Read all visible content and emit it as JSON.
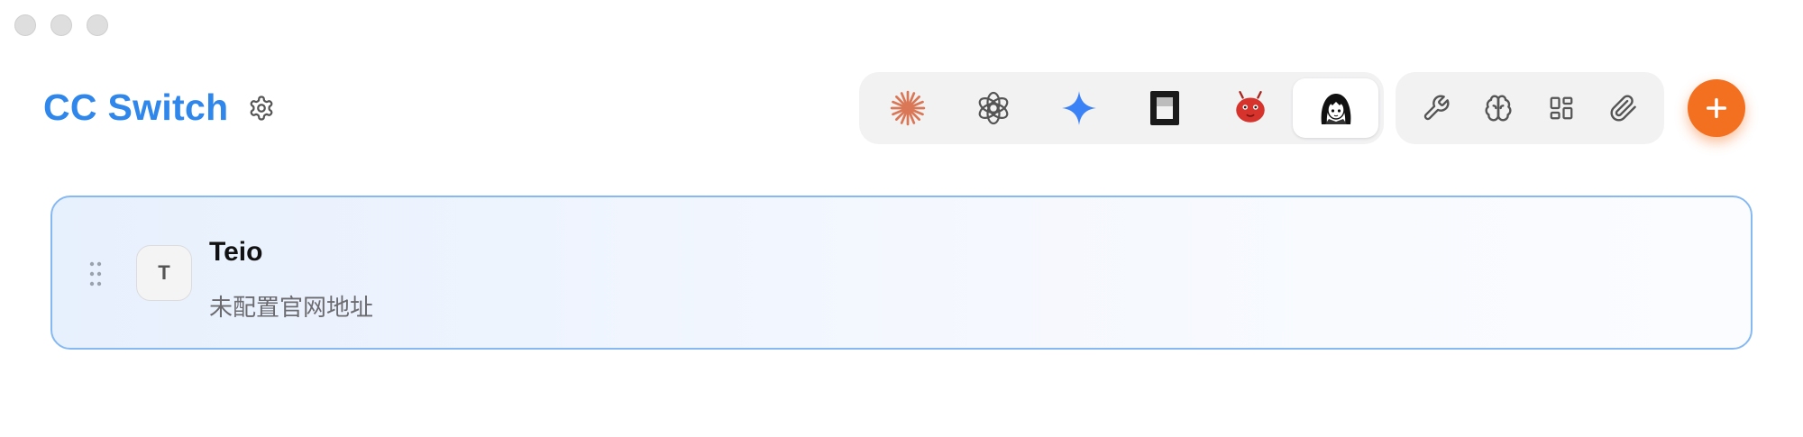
{
  "header": {
    "title": "CC Switch",
    "settings_icon": "gear-icon"
  },
  "app_switcher": {
    "tabs": [
      {
        "name": "claude",
        "icon": "claude-starburst-icon",
        "color": "#d97757",
        "active": false
      },
      {
        "name": "openai",
        "icon": "openai-knot-icon",
        "color": "#555555",
        "active": false
      },
      {
        "name": "gemini",
        "icon": "gemini-sparkle-icon",
        "color": "#3b82f6",
        "active": false
      },
      {
        "name": "terminal",
        "icon": "terminal-app-icon",
        "color": "#1a1a1a",
        "active": false
      },
      {
        "name": "red-mascot",
        "icon": "red-mascot-icon",
        "color": "#d6332c",
        "active": false
      },
      {
        "name": "anime-avatar",
        "icon": "anime-avatar-icon",
        "color": "#111111",
        "active": true
      }
    ]
  },
  "tools": {
    "items": [
      {
        "name": "wrench",
        "icon": "wrench-icon"
      },
      {
        "name": "brain",
        "icon": "brain-icon"
      },
      {
        "name": "grid",
        "icon": "grid-icon"
      },
      {
        "name": "paperclip",
        "icon": "paperclip-icon"
      }
    ]
  },
  "add_button": {
    "icon": "plus-icon",
    "color": "#f37021"
  },
  "provider": {
    "avatar_letter": "T",
    "name": "Teio",
    "url_text": "未配置官网地址"
  },
  "colors": {
    "accent": "#2f86eb",
    "card_border": "#86b9f2"
  }
}
